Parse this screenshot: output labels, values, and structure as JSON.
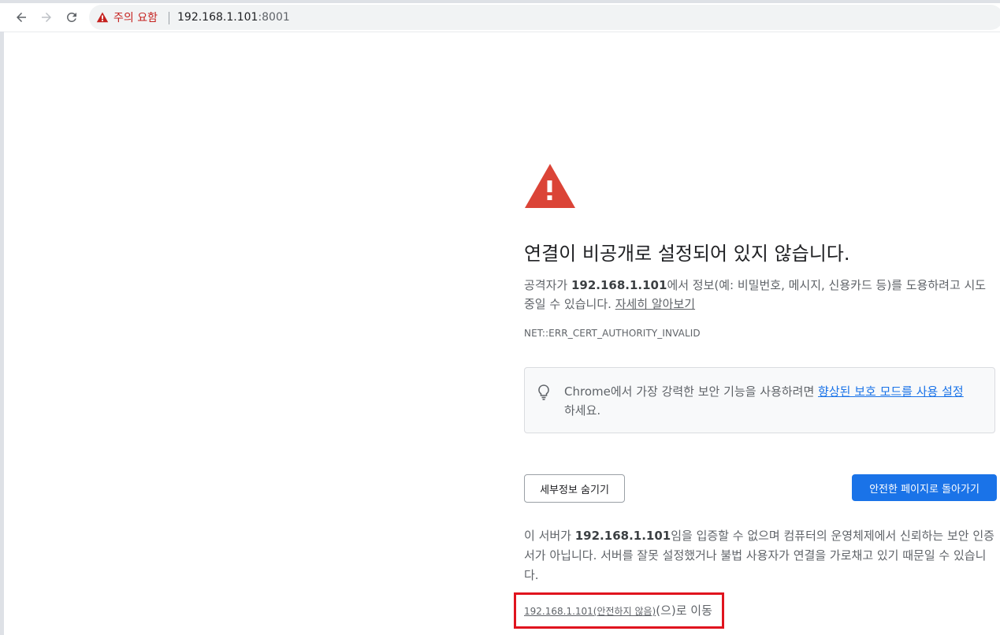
{
  "browser": {
    "security_chip_label": "주의 요함",
    "url_host": "192.168.1.101",
    "url_port": ":8001",
    "icons": [
      "back-arrow-icon",
      "forward-arrow-icon",
      "reload-icon",
      "warning-triangle-icon"
    ]
  },
  "interstitial": {
    "title": "연결이 비공개로 설정되어 있지 않습니다.",
    "explain_prefix": "공격자가 ",
    "host": "192.168.1.101",
    "explain_suffix": "에서 정보(예: 비밀번호, 메시지, 신용카드 등)를 도용하려고 시도 중일 수 있습니다. ",
    "learn_more": "자세히 알아보기",
    "error_code": "NET::ERR_CERT_AUTHORITY_INVALID",
    "tip_prefix": "Chrome에서 가장 강력한 보안 기능을 사용하려면 ",
    "tip_link": "향상된 보호 모드를 사용 설정",
    "tip_suffix": "하세요.",
    "details_button": "세부정보 숨기기",
    "back_button": "안전한 페이지로 돌아가기",
    "details_prefix": "이 서버가 ",
    "details_host": "192.168.1.101",
    "details_suffix": "임을 입증할 수 없으며 컴퓨터의 운영체제에서 신뢰하는 보안 인증서가 아닙니다. 서버를 잘못 설정했거나 불법 사용자가 연결을 가로채고 있기 때문일 수 있습니다.",
    "proceed_link": "192.168.1.101(안전하지 않음)",
    "proceed_suffix": "(으)로 이동"
  },
  "colors": {
    "warning_red": "#c5221f",
    "icon_red": "#db4437",
    "primary_blue": "#1a73e8",
    "highlight_box": "#e0141e"
  }
}
